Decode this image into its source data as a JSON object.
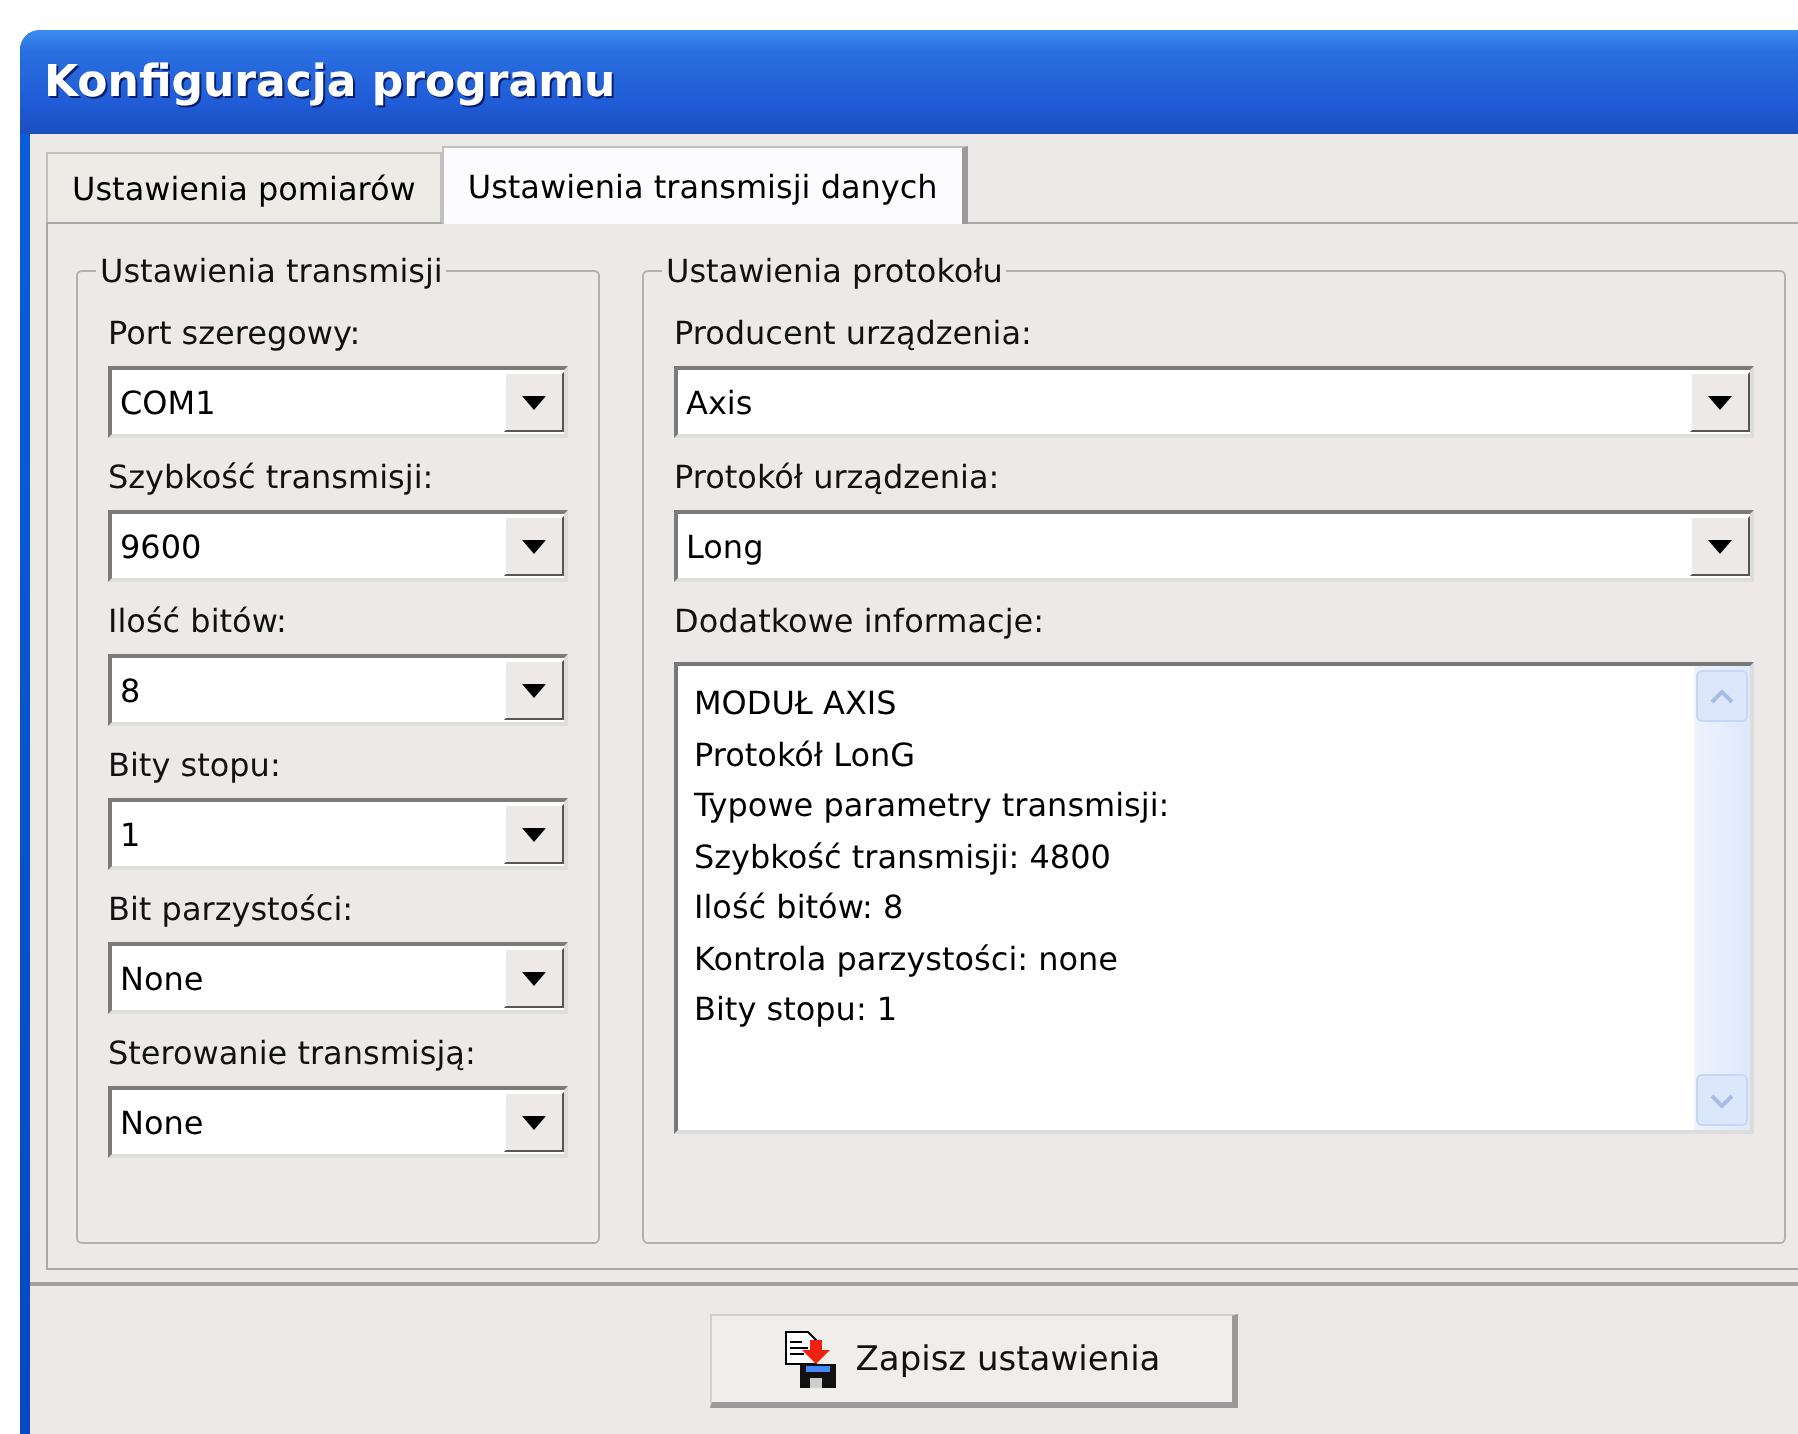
{
  "window": {
    "title": "Konfiguracja programu"
  },
  "tabs": [
    {
      "label": "Ustawienia pomiarów",
      "selected": false
    },
    {
      "label": "Ustawienia transmisji danych",
      "selected": true
    }
  ],
  "transmission": {
    "title": "Ustawienia transmisji",
    "fields": [
      {
        "label": "Port szeregowy:",
        "value": "COM1"
      },
      {
        "label": "Szybkość transmisji:",
        "value": "9600"
      },
      {
        "label": "Ilość bitów:",
        "value": "8"
      },
      {
        "label": "Bity stopu:",
        "value": "1"
      },
      {
        "label": "Bit parzystości:",
        "value": "None"
      },
      {
        "label": "Sterowanie transmisją:",
        "value": "None"
      }
    ]
  },
  "protocol": {
    "title": "Ustawienia protokołu",
    "fields": [
      {
        "label": "Producent urządzenia:",
        "value": "Axis"
      },
      {
        "label": "Protokół urządzenia:",
        "value": "Long"
      }
    ],
    "info_label": "Dodatkowe informacje:",
    "info_lines": [
      "MODUŁ AXIS",
      "Protokół LonG",
      "Typowe parametry transmisji:",
      "Szybkość transmisji: 4800",
      "Ilość bitów: 8",
      "Kontrola parzystości: none",
      "Bity stopu: 1"
    ]
  },
  "save_button": {
    "label": "Zapisz ustawienia"
  }
}
